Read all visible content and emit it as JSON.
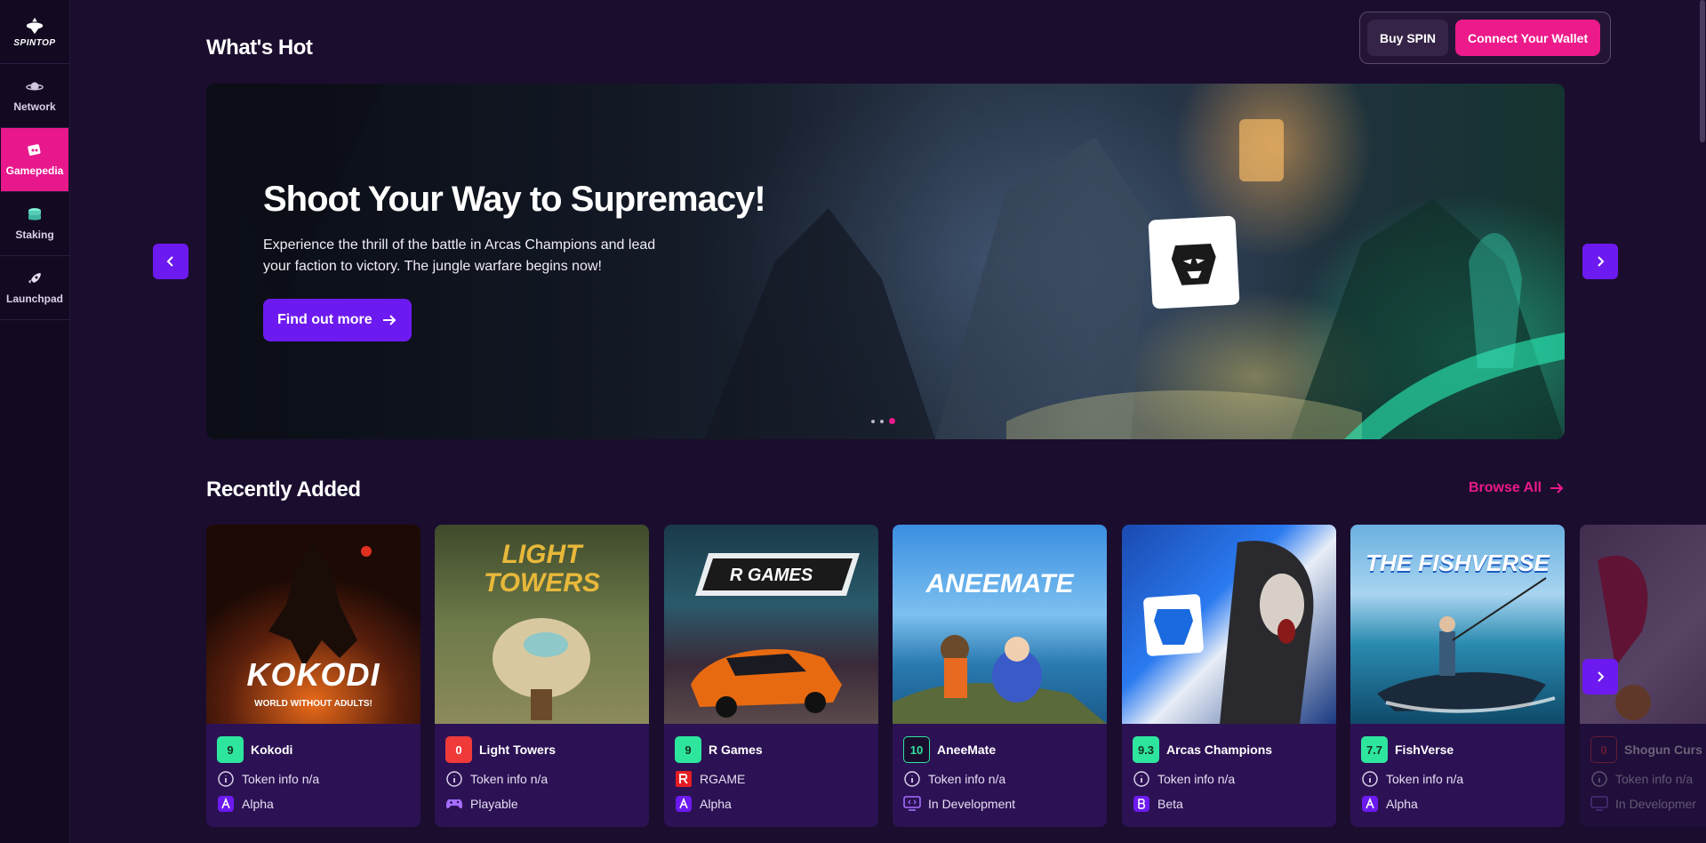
{
  "brand": {
    "logo_text": "SPINTOP"
  },
  "sidebar": {
    "items": [
      {
        "label": "Network",
        "icon": "planet-icon"
      },
      {
        "label": "Gamepedia",
        "icon": "cards-icon",
        "active": true
      },
      {
        "label": "Staking",
        "icon": "coins-icon"
      },
      {
        "label": "Launchpad",
        "icon": "rocket-icon"
      }
    ]
  },
  "header": {
    "buy_label": "Buy SPIN",
    "connect_label": "Connect Your Wallet"
  },
  "whats_hot": {
    "title": "What's Hot",
    "slide": {
      "title": "Shoot Your Way to Supremacy!",
      "description": "Experience the thrill of the battle in Arcas Champions and lead your faction to victory. The jungle warfare begins now!",
      "button_label": "Find out more"
    },
    "slides_count": 3,
    "active_slide": 3
  },
  "recently_added": {
    "title": "Recently Added",
    "browse_all": "Browse All",
    "cards": [
      {
        "name": "Kokodi",
        "score": "9",
        "score_color": "#2ee59d",
        "token": "Token info n/a",
        "token_icon": "info-icon",
        "stage": "Alpha",
        "stage_icon": "alpha-icon",
        "art_title": "KOKODI",
        "art_subtitle": "WORLD WITHOUT ADULTS!"
      },
      {
        "name": "Light Towers",
        "score": "0",
        "score_color": "#f03a3a",
        "token": "Token info n/a",
        "token_icon": "info-icon",
        "stage": "Playable",
        "stage_icon": "gamepad-icon",
        "art_title": "LIGHT TOWERS"
      },
      {
        "name": "R Games",
        "score": "9",
        "score_color": "#2ee59d",
        "token": "RGAME",
        "token_icon": "rgame-token-icon",
        "stage": "Alpha",
        "stage_icon": "alpha-icon",
        "art_title": "R GAMES"
      },
      {
        "name": "AneeMate",
        "score": "10",
        "score_color": "#1b0d2e",
        "token": "Token info n/a",
        "token_icon": "info-icon",
        "stage": "In Development",
        "stage_icon": "dev-icon",
        "art_title": "ANEEMATE"
      },
      {
        "name": "Arcas Champions",
        "score": "9.3",
        "score_color": "#2ee59d",
        "token": "Token info n/a",
        "token_icon": "info-icon",
        "stage": "Beta",
        "stage_icon": "beta-icon"
      },
      {
        "name": "FishVerse",
        "score": "7.7",
        "score_color": "#2ee59d",
        "token": "Token info n/a",
        "token_icon": "info-icon",
        "stage": "Alpha",
        "stage_icon": "alpha-icon",
        "art_title": "THE FISHVERSE"
      },
      {
        "name": "Shogun Curs",
        "score": "0",
        "score_color": "#f03a3a",
        "token": "Token info n/a",
        "token_icon": "info-icon",
        "stage": "In Developmer",
        "stage_icon": "dev-icon"
      }
    ]
  },
  "colors": {
    "accent_pink": "#ec1a8a",
    "accent_purple": "#6c1aef",
    "score_green": "#2ee59d",
    "score_red": "#f03a3a",
    "card_bg": "#2c1254"
  }
}
